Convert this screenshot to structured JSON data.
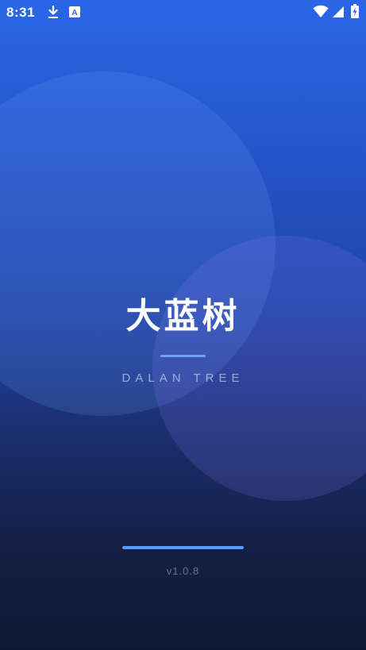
{
  "status_bar": {
    "time": "8:31",
    "notification_icons": [
      "download-icon",
      "app-a-icon"
    ],
    "system_icons": [
      "wifi-icon",
      "signal-icon",
      "battery-charging-icon"
    ],
    "notification_letter": "A"
  },
  "splash": {
    "title": "大蓝树",
    "subtitle": "DALAN TREE",
    "loading_progress": 1.0,
    "version": "v1.0.8"
  },
  "colors": {
    "background_top": "#2a67e6",
    "background_bottom": "#0f1833",
    "accent": "#5b9aff",
    "divider": "#6aa2ff",
    "text": "#ffffff"
  }
}
